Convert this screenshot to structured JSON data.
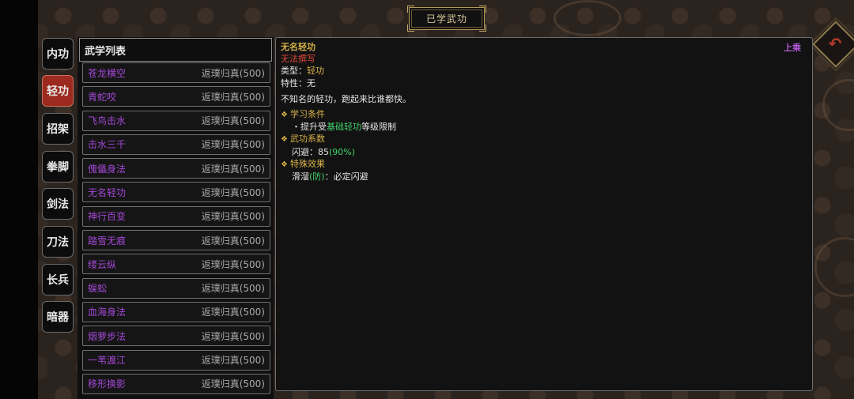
{
  "window_title": "已学武功",
  "back_button_icon": "back-arrow-icon",
  "categories": [
    {
      "label": "内功",
      "active": false
    },
    {
      "label": "轻功",
      "active": true
    },
    {
      "label": "招架",
      "active": false
    },
    {
      "label": "拳脚",
      "active": false
    },
    {
      "label": "剑法",
      "active": false
    },
    {
      "label": "刀法",
      "active": false
    },
    {
      "label": "长兵",
      "active": false
    },
    {
      "label": "暗器",
      "active": false
    }
  ],
  "skill_list": {
    "header": "武学列表",
    "items": [
      {
        "name": "苍龙横空",
        "req": "返璞归真(500)"
      },
      {
        "name": "青蛇咬",
        "req": "返璞归真(500)"
      },
      {
        "name": "飞鸟击水",
        "req": "返璞归真(500)"
      },
      {
        "name": "击水三千",
        "req": "返璞归真(500)"
      },
      {
        "name": "傀儡身法",
        "req": "返璞归真(500)"
      },
      {
        "name": "无名轻功",
        "req": "返璞归真(500)"
      },
      {
        "name": "神行百变",
        "req": "返璞归真(500)"
      },
      {
        "name": "踏雪无痕",
        "req": "返璞归真(500)"
      },
      {
        "name": "缕云纵",
        "req": "返璞归真(500)"
      },
      {
        "name": "蜈蚣",
        "req": "返璞归真(500)"
      },
      {
        "name": "血海身法",
        "req": "返璞归真(500)"
      },
      {
        "name": "烟萝步法",
        "req": "返璞归真(500)"
      },
      {
        "name": "一苇渡江",
        "req": "返璞归真(500)"
      },
      {
        "name": "移形换影",
        "req": "返璞归真(500)"
      }
    ]
  },
  "detail": {
    "title": "无名轻功",
    "equip_label": "上乘",
    "warning": "无法撰写",
    "type_label": "类型：",
    "type_value": "轻功",
    "trait_label": "特性：",
    "trait_value": "无",
    "description": "不知名的轻功，跑起来比谁都快。",
    "learn_heading": "学习条件",
    "learn_prefix": "・提升受",
    "learn_highlight": "基础轻功",
    "learn_suffix": "等级限制",
    "coef_heading": "武功系数",
    "coef_label": "闪避：",
    "coef_value": "85",
    "coef_pct": "(90%)",
    "effect_heading": "特殊效果",
    "effect_name": "滑溜",
    "effect_tag": "(防)",
    "effect_desc": "：必定闪避"
  },
  "colors": {
    "active_tab": "#9c2a1f",
    "skill_name": "#a347d6",
    "gold_text": "#d7b24a",
    "green_text": "#44d26b",
    "warn_text": "#e04a3a"
  }
}
